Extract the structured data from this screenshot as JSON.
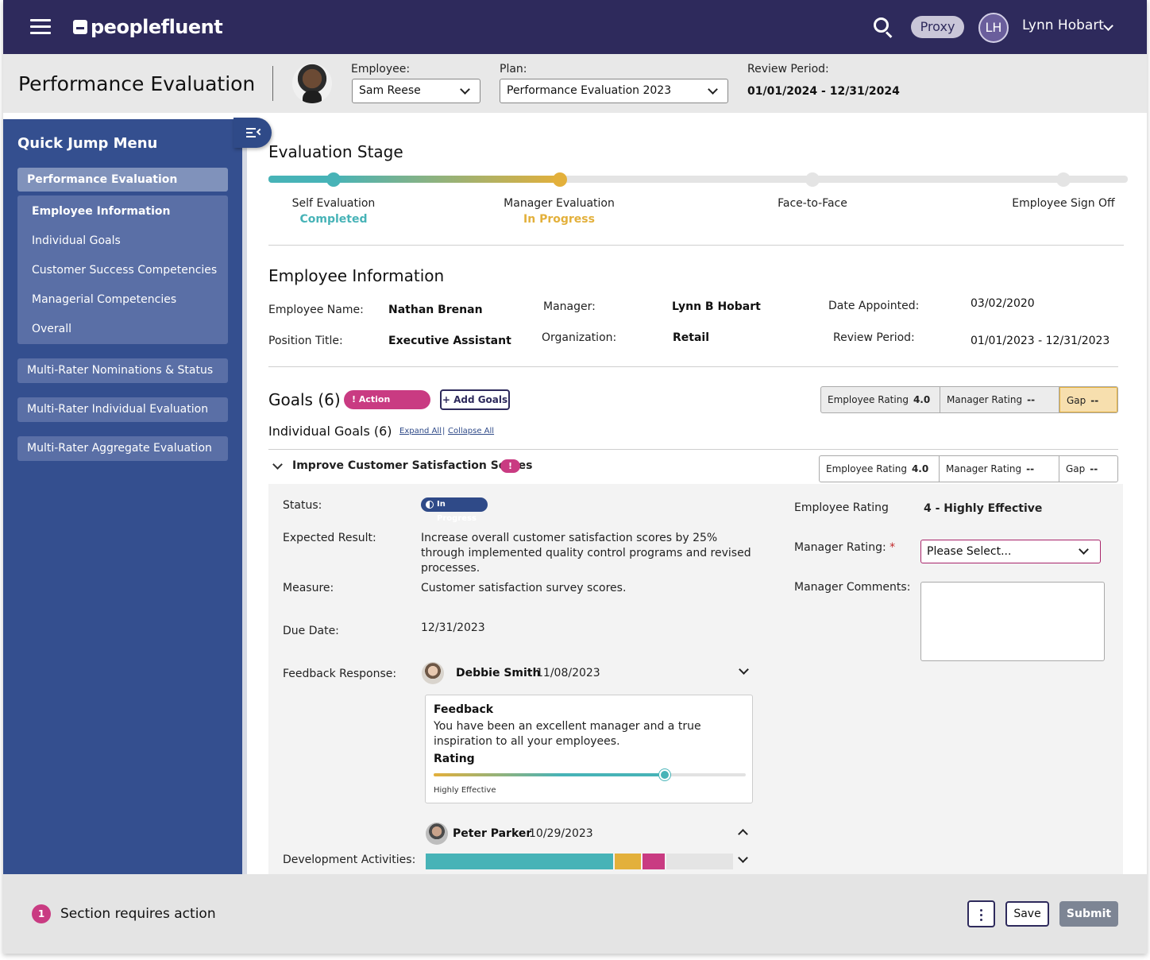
{
  "topnav": {
    "logo_text": "peoplefluent",
    "proxy_label": "Proxy",
    "user_initials": "LH",
    "user_name": "Lynn Hobart"
  },
  "header": {
    "page_title": "Performance Evaluation",
    "employee_label": "Employee:",
    "employee_value": "Sam Reese",
    "plan_label": "Plan:",
    "plan_value": "Performance Evaluation 2023",
    "review_period_label": "Review Period:",
    "review_period_value": "01/01/2024 - 12/31/2024"
  },
  "sidebar": {
    "title": "Quick Jump Menu",
    "main_item": "Performance Evaluation",
    "sub_items": [
      "Employee Information",
      "Individual Goals",
      "Customer Success Competencies",
      "Managerial Competencies",
      "Overall"
    ],
    "other_items": [
      "Multi-Rater Nominations & Status",
      "Multi-Rater Individual Evaluation",
      "Multi-Rater Aggregate Evaluation"
    ]
  },
  "stage": {
    "title": "Evaluation Stage",
    "steps": [
      {
        "label": "Self Evaluation",
        "status": "Completed"
      },
      {
        "label": "Manager Evaluation",
        "status": "In Progress"
      },
      {
        "label": "Face-to-Face",
        "status": ""
      },
      {
        "label": "Employee Sign Off",
        "status": ""
      }
    ],
    "colors": {
      "completed": "#47b3b7",
      "in_progress": "#e3b03b",
      "pending": "#e4e4e4"
    }
  },
  "employee_info": {
    "title": "Employee Information",
    "employee_name_label": "Employee Name:",
    "employee_name": "Nathan Brenan",
    "manager_label": "Manager:",
    "manager": "Lynn B Hobart",
    "date_appointed_label": "Date Appointed:",
    "date_appointed": "03/02/2020",
    "position_label": "Position Title:",
    "position": "Executive Assistant",
    "organization_label": "Organization:",
    "organization": "Retail",
    "review_period_label": "Review Period:",
    "review_period": "01/01/2023 - 12/31/2023"
  },
  "goals": {
    "title": "Goals (6)",
    "action_required": "Action Required",
    "add_goals": "Add Goals",
    "summary": {
      "employee_rating_label": "Employee Rating",
      "employee_rating": "4.0",
      "manager_rating_label": "Manager Rating",
      "manager_rating": "--",
      "gap_label": "Gap",
      "gap": "--"
    },
    "individual_title": "Individual Goals (6)",
    "expand_all": "Expand All",
    "separator": "|",
    "collapse_all": "Collapse All"
  },
  "goal": {
    "title": "Improve Customer Satisfaction Scores",
    "alert": "!",
    "rating": {
      "employee_rating_label": "Employee Rating",
      "employee_rating": "4.0",
      "manager_rating_label": "Manager Rating",
      "manager_rating": "--",
      "gap_label": "Gap",
      "gap": "--"
    },
    "status_label": "Status:",
    "status": "In Progress",
    "expected_result_label": "Expected Result:",
    "expected_result": "Increase overall customer satisfaction scores by 25%  through implemented quality control programs and revised processes.",
    "measure_label": "Measure:",
    "measure": "Customer satisfaction survey scores.",
    "due_date_label": "Due Date:",
    "due_date": "12/31/2023",
    "feedback_label": "Feedback Response:",
    "development_label": "Development Activities:",
    "employee_rating_label": "Employee Rating",
    "employee_rating_value": "4 - Highly Effective",
    "manager_rating_label": "Manager Rating:",
    "required_mark": "*",
    "manager_rating_placeholder": "Please Select...",
    "manager_comments_label": "Manager Comments:"
  },
  "feedback": [
    {
      "name": "Debbie Smith",
      "date": "11/08/2023",
      "heading": "Feedback",
      "text": "You have been an excellent manager and a true inspiration to all your employees.",
      "rating_heading": "Rating",
      "rating_fraction": 0.74,
      "rating_label": "Highly Effective"
    },
    {
      "name": "Peter Parker",
      "date": "10/29/2023"
    }
  ],
  "development_bar": [
    {
      "fraction": 0.62,
      "color": "#47b3b7"
    },
    {
      "fraction": 0.085,
      "color": "#e3b03b"
    },
    {
      "fraction": 0.075,
      "color": "#c93b82"
    },
    {
      "fraction": 0.22,
      "color": "#e4e4e4"
    }
  ],
  "footer": {
    "count": "1",
    "message": "Section requires action",
    "save": "Save",
    "submit": "Submit"
  }
}
